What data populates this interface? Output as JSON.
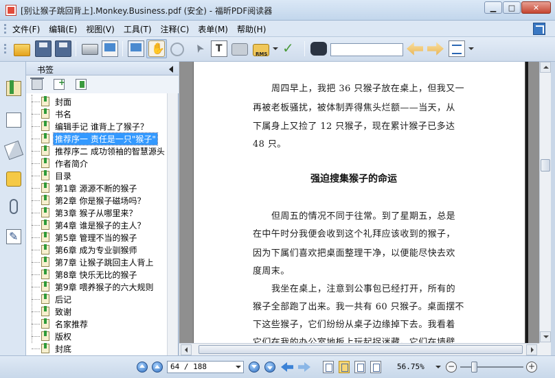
{
  "window": {
    "title": "[别让猴子跳回背上].Monkey.Business.pdf (安全) - 福昕PDF阅读器",
    "min_glyph": "▁",
    "max_glyph": "□",
    "close_glyph": "✕"
  },
  "menu": {
    "items": [
      {
        "label": "文件(F)"
      },
      {
        "label": "编辑(E)"
      },
      {
        "label": "视图(V)"
      },
      {
        "label": "工具(T)"
      },
      {
        "label": "注释(C)"
      },
      {
        "label": "表单(M)"
      },
      {
        "label": "帮助(H)"
      }
    ]
  },
  "toolbar": {
    "rms_label": "RMS",
    "search_value": ""
  },
  "bookmarks": {
    "title": "书签",
    "items": [
      {
        "label": "封面"
      },
      {
        "label": "书名"
      },
      {
        "label": "编辑手记 谁背上了猴子？"
      },
      {
        "label": "推荐序一 责任是一只\"猴子\"",
        "selected": true
      },
      {
        "label": "推荐序二 成功领袖的智慧源头"
      },
      {
        "label": "作者简介"
      },
      {
        "label": "目录"
      },
      {
        "label": "第1章 源源不断的猴子"
      },
      {
        "label": "第2章 你是猴子磁场吗？"
      },
      {
        "label": "第3章 猴子从哪里来？"
      },
      {
        "label": "第4章 谁是猴子的主人？"
      },
      {
        "label": "第5章 管理不当的猴子"
      },
      {
        "label": "第6章 成为专业驯猴师"
      },
      {
        "label": "第7章 让猴子跳回主人背上"
      },
      {
        "label": "第8章 快乐无比的猴子"
      },
      {
        "label": "第9章 喂养猴子的六大规则"
      },
      {
        "label": "后记"
      },
      {
        "label": "致谢"
      },
      {
        "label": "名家推荐"
      },
      {
        "label": "版权"
      },
      {
        "label": "封底"
      }
    ]
  },
  "document": {
    "lines": [
      "周四早上，我把 36 只猴子放在桌上，但我又一",
      "再被老板骚扰，被体制弄得焦头烂额——当天，从",
      "下属身上又捡了 12 只猴子，现在累计猴子已多达",
      "48 只。"
    ],
    "heading": "强迫搜集猴子的命运",
    "lines2": [
      "但周五的情况不同于往常。到了星期五，总是",
      "在中午时分我便会收到这个礼拜应该收到的猴子，",
      "因为下属们喜欢把桌面整理干净，以便能尽快去欢",
      "度周末。"
    ],
    "lines3": [
      "我坐在桌上，注意到公事包已经打开，所有的",
      "猴子全部跑了出来。我一共有 60 只猴子。桌面摆不",
      "下这些猴子，它们纷纷从桌子边缘掉下去。我看着",
      "它们在我的办公室地板上玩起捉迷藏。它们在墙壁"
    ]
  },
  "status": {
    "page_indicator": "64 / 188",
    "zoom": "56.75%",
    "zoom_level_percent": 56.75,
    "zoom_out_glyph": "−",
    "zoom_in_glyph": "+"
  }
}
